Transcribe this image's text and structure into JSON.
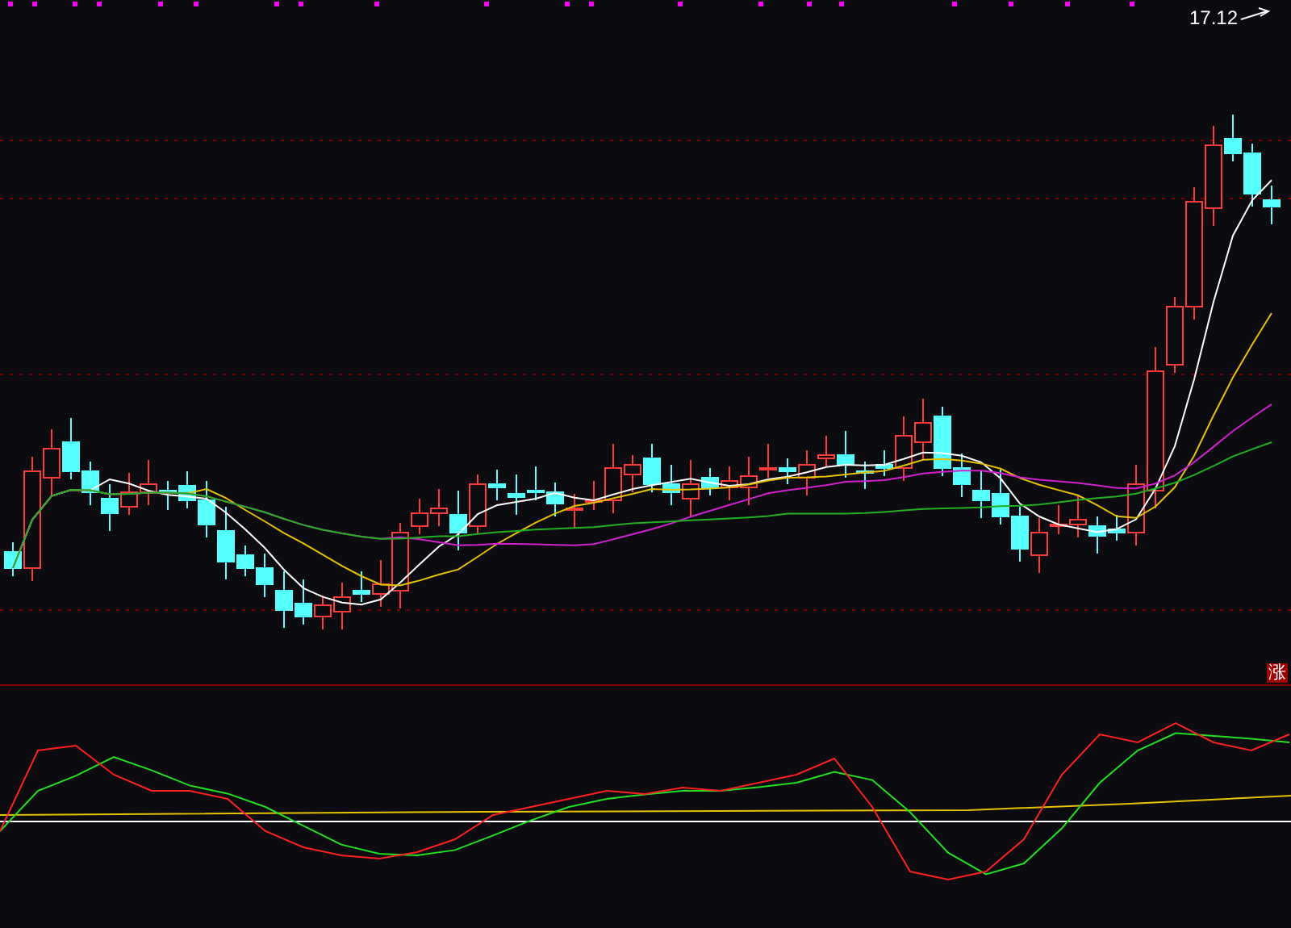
{
  "price_chart": {
    "max_price_label": "17.12"
  },
  "indicator_panel": {
    "badge": "涨"
  }
}
